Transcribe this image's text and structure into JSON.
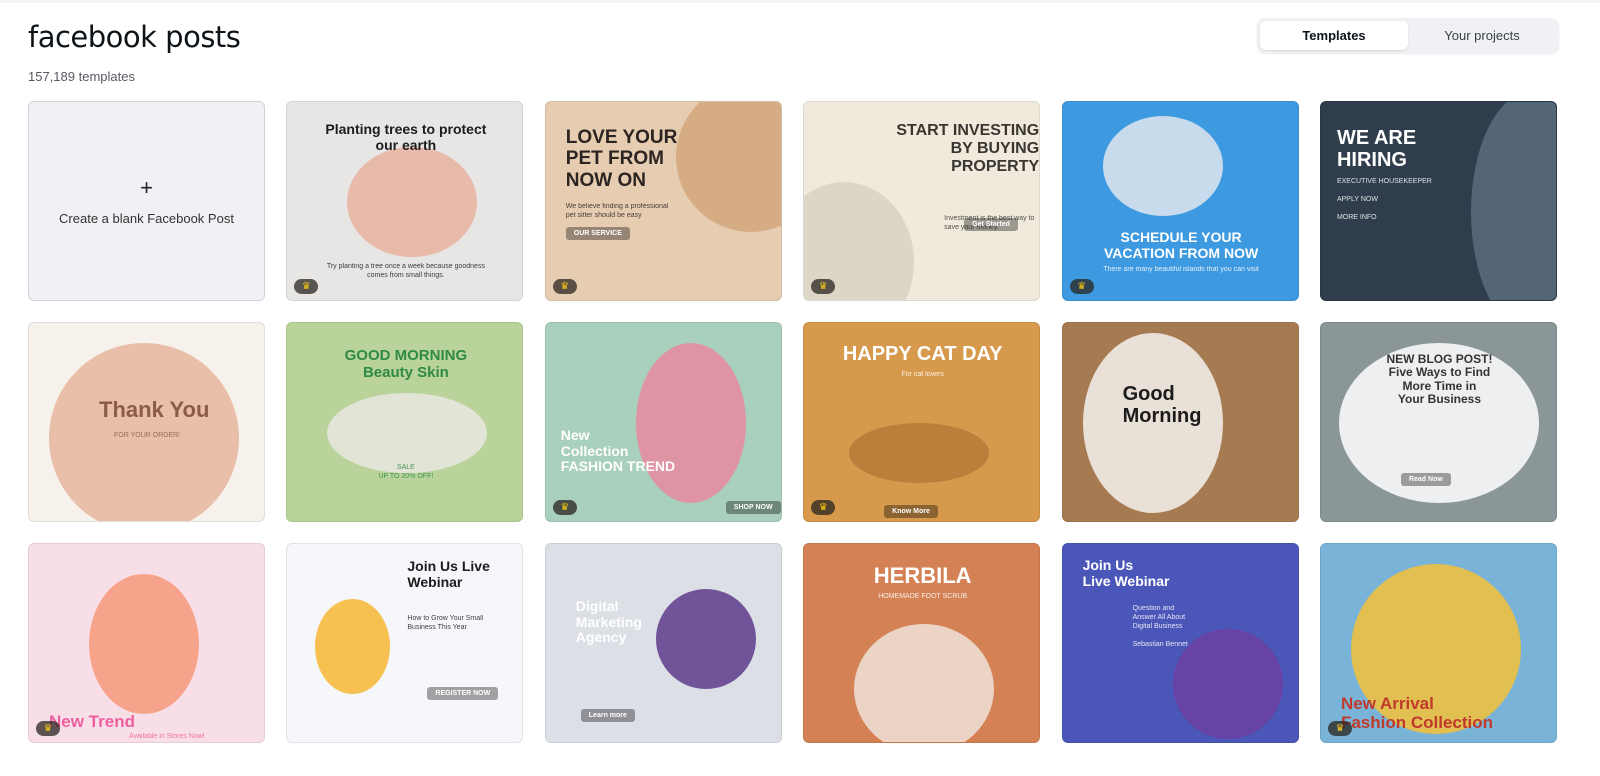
{
  "header": {
    "title": "facebook posts",
    "count": "157,189 templates"
  },
  "tabs": [
    {
      "label": "Templates",
      "active": true
    },
    {
      "label": "Your projects",
      "active": false
    }
  ],
  "blank": {
    "icon": "plus-icon",
    "label": "Create a blank Facebook Post"
  },
  "tiles": [
    {
      "bg": "#e7e6e4",
      "accent": "#e6b19f",
      "head": "Planting trees to protect\nour earth",
      "headColor": "#1c1c1c",
      "sub": "Try planting a tree once a week because goodness\ncomes from small things.",
      "crown": true
    },
    {
      "bg": "#e6cdb2",
      "accent": "#d2a67d",
      "head": "LOVE YOUR\nPET FROM\nNOW ON",
      "headColor": "#2b2420",
      "sub": "We believe finding a professional\npet sitter should be easy",
      "btn": "OUR SERVICE",
      "crown": true
    },
    {
      "bg": "#efeadb",
      "accent": "#d8d2c3",
      "head": "START INVESTING\nBY BUYING\nPROPERTY",
      "headColor": "#3a3530",
      "sub": "Investment is the best way to\nsave your money.",
      "btn": "Get Started",
      "crown": true
    },
    {
      "bg": "#3d9ae0",
      "accent": "#dfe6ee",
      "head": "SCHEDULE YOUR\nVACATION FROM NOW",
      "headColor": "#ffffff",
      "sub": "There are many beautiful islands that you can visit",
      "crown": true
    },
    {
      "bg": "#2f3d4c",
      "accent": "#5b6c7c",
      "head": "WE ARE\nHIRING",
      "headColor": "#ffffff",
      "sub": "EXECUTIVE HOUSEKEEPER\n\nAPPLY NOW\n\nMORE INFO",
      "crown": false
    },
    {
      "bg": "#f6f1ea",
      "accent": "#e8b69f",
      "head": "Thank You",
      "headColor": "#8a5c4a",
      "sub": "FOR YOUR ORDER!",
      "crown": false
    },
    {
      "bg": "#b9d39a",
      "accent": "#e9e6e0",
      "head": "GOOD MORNING\nBeauty Skin",
      "headColor": "#2f8a45",
      "sub": "SALE\nUP TO 20% OFF!",
      "crown": false
    },
    {
      "bg": "#a9cfbd",
      "accent": "#e98aa0",
      "head": "New\nCollection\nFASHION TREND",
      "headColor": "#ffffff",
      "btn": "SHOP NOW",
      "crown": true
    },
    {
      "bg": "#d79a4c",
      "accent": "#b9793a",
      "head": "HAPPY CAT DAY",
      "headColor": "#ffffff",
      "sub": "For cat lovers",
      "btn": "Know More",
      "crown": true
    },
    {
      "bg": "#a77b52",
      "accent": "#f4f2ee",
      "head": "Good\nMorning",
      "headColor": "#1c1c1c",
      "crown": false
    },
    {
      "bg": "#8b9698",
      "accent": "#ffffff",
      "head": "NEW BLOG POST!\nFive Ways to Find\nMore Time in\nYour Business",
      "headColor": "#333333",
      "btn": "Read Now",
      "crown": false
    },
    {
      "bg": "#f8dfe7",
      "accent": "#f49a7a",
      "head": "New Trend",
      "headColor": "#ee5fa0",
      "sub": "Available in Stores Now!",
      "crown": true
    },
    {
      "bg": "#f5f7fa",
      "accent": "#f7b733",
      "head": "Join Us Live\nWebinar",
      "headColor": "#1c1c1c",
      "sub": "How to Grow Your Small\nBusiness This Year",
      "btn": "REGISTER NOW",
      "crown": false
    },
    {
      "bg": "#dcdfe6",
      "accent": "#5e3b8c",
      "head": "Digital\nMarketing\nAgency",
      "headColor": "#ffffff",
      "btn": "Learn more",
      "crown": false
    },
    {
      "bg": "#d48255",
      "accent": "#efe3d9",
      "head": "HERBILA",
      "headColor": "#ffffff",
      "sub": "HOMEMADE FOOT SCRUB",
      "crown": false
    },
    {
      "bg": "#4b57b8",
      "accent": "#6b3fa0",
      "head": "Join Us\nLive Webinar",
      "headColor": "#ffffff",
      "sub": "Question and\nAnswer All About\nDigital Business\n\nSebastian Bennet",
      "crown": false
    },
    {
      "bg": "#79b4d8",
      "accent": "#f3c13a",
      "head": "New Arrival\nFashion Collection",
      "headColor": "#c0392b",
      "crown": true
    }
  ]
}
